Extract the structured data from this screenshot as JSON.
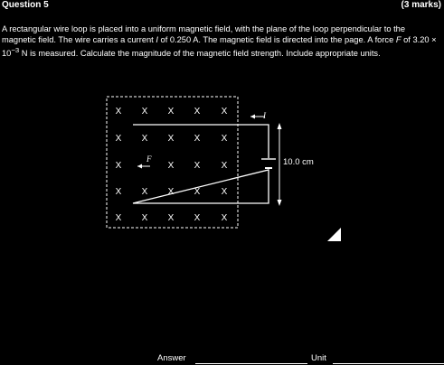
{
  "header": {
    "title": "Question 5",
    "marks": "(3 marks)"
  },
  "question": {
    "p1": "A rectangular wire loop is placed into a uniform magnetic field, with the plane of the loop perpendicular to the magnetic field. The wire carries a current ",
    "i1": "I",
    "p2": " of 0.250 A. The magnetic field is directed into the page. A force ",
    "i2": "F",
    "p3": " of 3.20 × 10",
    "sup": "−3",
    "p4": " N is measured. Calculate the magnitude of the magnetic field strength. Include appropriate units."
  },
  "diagram": {
    "field_symbol": "X",
    "current_label": "I",
    "force_label": "F",
    "dimension_label": "10.0 cm"
  },
  "answer": {
    "answer_label": "Answer",
    "unit_label": "Unit"
  }
}
